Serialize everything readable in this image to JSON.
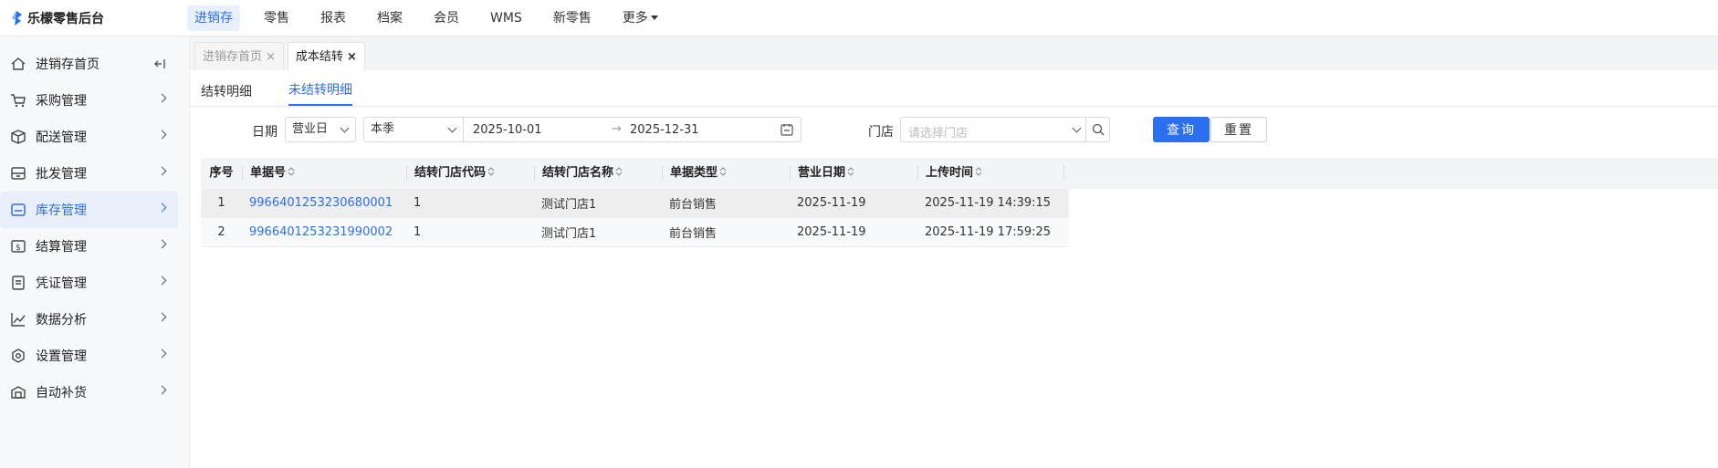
{
  "app": {
    "title": "乐檬零售后台"
  },
  "topnav": [
    {
      "label": "进销存",
      "active": true
    },
    {
      "label": "零售",
      "active": false
    },
    {
      "label": "报表",
      "active": false
    },
    {
      "label": "档案",
      "active": false
    },
    {
      "label": "会员",
      "active": false
    },
    {
      "label": "WMS",
      "active": false
    },
    {
      "label": "新零售",
      "active": false
    },
    {
      "label": "更多",
      "active": false
    }
  ],
  "sidebar": {
    "items": [
      {
        "label": "进销存首页",
        "icon": "home-icon"
      },
      {
        "label": "采购管理",
        "icon": "cart-icon"
      },
      {
        "label": "配送管理",
        "icon": "delivery-icon"
      },
      {
        "label": "批发管理",
        "icon": "wholesale-icon"
      },
      {
        "label": "库存管理",
        "icon": "inventory-icon"
      },
      {
        "label": "结算管理",
        "icon": "settlement-icon"
      },
      {
        "label": "凭证管理",
        "icon": "voucher-icon"
      },
      {
        "label": "数据分析",
        "icon": "chart-icon"
      },
      {
        "label": "设置管理",
        "icon": "settings-icon"
      },
      {
        "label": "自动补货",
        "icon": "replenish-icon"
      }
    ],
    "active_index": 4
  },
  "page_tabs": [
    {
      "label": "进销存首页",
      "close": "×"
    },
    {
      "label": "成本结转",
      "close": "×"
    }
  ],
  "sub_tabs": [
    {
      "label": "结转明细"
    },
    {
      "label": "未结转明细"
    }
  ],
  "filters": {
    "date_label": "日期",
    "date_type": "营业日",
    "period": "本季",
    "start_date": "2025-10-01",
    "range_arrow": "→",
    "end_date": "2025-12-31",
    "store_label": "门店",
    "store_placeholder": "请选择门店",
    "query_button": "查询",
    "reset_button": "重置"
  },
  "table": {
    "headers": [
      "序号",
      "单据号",
      "结转门店代码",
      "结转门店名称",
      "单据类型",
      "营业日期",
      "上传时间"
    ],
    "rows": [
      [
        "1",
        "9966401253230680001",
        "1",
        "测试门店1",
        "前台销售",
        "2025-11-19",
        "2025-11-19 14:39:15"
      ],
      [
        "2",
        "9966401253231990002",
        "1",
        "测试门店1",
        "前台销售",
        "2025-11-19",
        "2025-11-19 17:59:25"
      ]
    ]
  },
  "colors": {
    "accent": "#2f6fe4",
    "primary_button": "#2a6ff0",
    "sidebar_bg": "#f7f8fa"
  }
}
